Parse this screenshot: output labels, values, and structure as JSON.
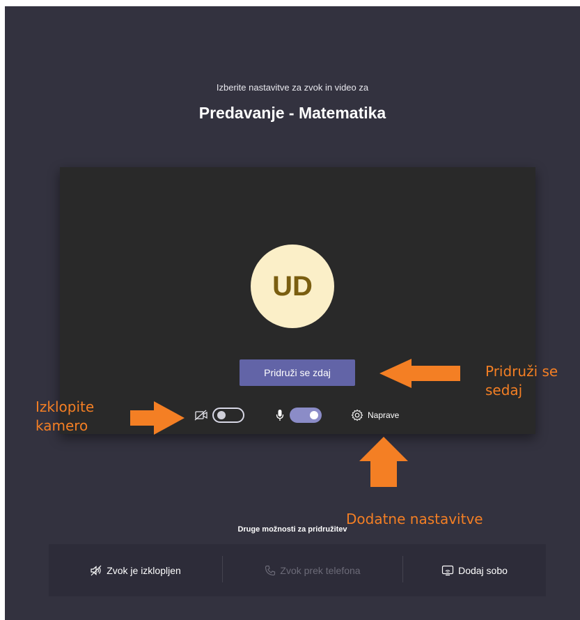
{
  "header": {
    "subtitle": "Izberite nastavitve za zvok in video za",
    "meeting_title": "Predavanje - Matematika"
  },
  "preview": {
    "avatar_initials": "UD",
    "join_button": "Pridruži se zdaj",
    "camera": {
      "icon": "camera-off-icon",
      "enabled": false
    },
    "microphone": {
      "icon": "microphone-icon",
      "enabled": true
    },
    "devices_label": "Naprave",
    "devices_icon": "gear-icon"
  },
  "other_options": {
    "title": "Druge možnosti za pridružitev",
    "items": [
      {
        "label": "Zvok je izklopljen",
        "icon": "speaker-off-icon",
        "enabled": true
      },
      {
        "label": "Zvok prek telefona",
        "icon": "phone-icon",
        "enabled": false
      },
      {
        "label": "Dodaj sobo",
        "icon": "cast-room-icon",
        "enabled": true
      }
    ]
  },
  "annotations": {
    "join_note": [
      "Pridruži se",
      "sedaj"
    ],
    "camera_note": [
      "Izklopite",
      "kamero"
    ],
    "settings_note": "Dodatne nastavitve"
  },
  "colors": {
    "background": "#33323f",
    "preview": "#292929",
    "accent": "#6264a7",
    "avatar": "#fbefc8",
    "annotation": "#f47f24"
  }
}
